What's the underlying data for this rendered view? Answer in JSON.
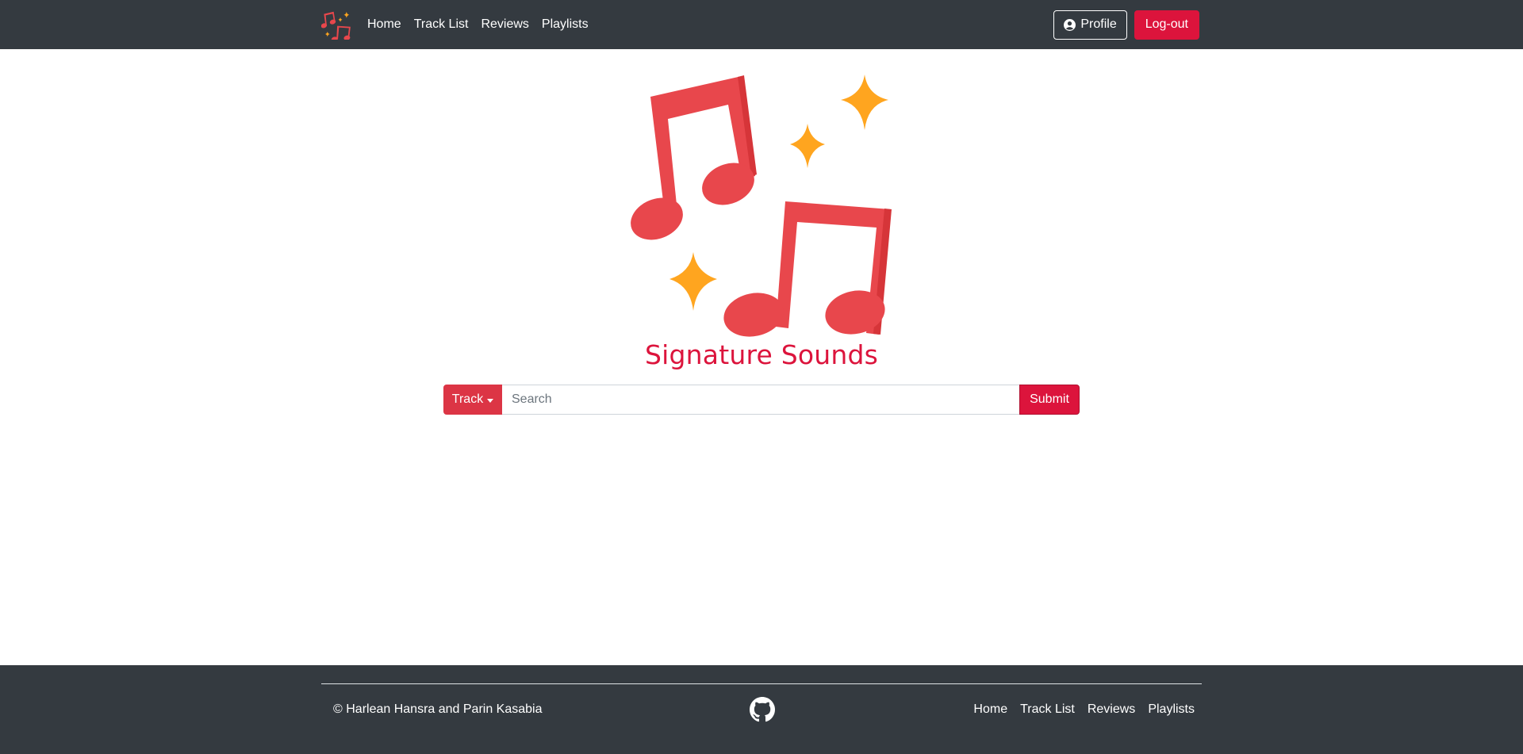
{
  "navbar": {
    "brand_icon": "music-notes-sparkles-icon",
    "links": [
      {
        "label": "Home"
      },
      {
        "label": "Track List"
      },
      {
        "label": "Reviews"
      },
      {
        "label": "Playlists"
      }
    ],
    "profile_label": "Profile",
    "profile_icon": "user-circle-icon",
    "logout_label": "Log-out"
  },
  "hero": {
    "logo_icon": "music-notes-sparkles-icon",
    "title": "Signature Sounds"
  },
  "search": {
    "type_label": "Track",
    "placeholder": "Search",
    "value": "",
    "submit_label": "Submit"
  },
  "footer": {
    "copyright": "© Harlean Hansra and Parin Kasabia",
    "github_icon": "github-icon",
    "links": [
      {
        "label": "Home"
      },
      {
        "label": "Track List"
      },
      {
        "label": "Reviews"
      },
      {
        "label": "Playlists"
      }
    ]
  },
  "colors": {
    "navbar_bg": "#343a40",
    "accent": "#dc143c",
    "track_button": "#dc3545",
    "note_red": "#e8474c",
    "sparkle_orange": "#ffa51f"
  }
}
